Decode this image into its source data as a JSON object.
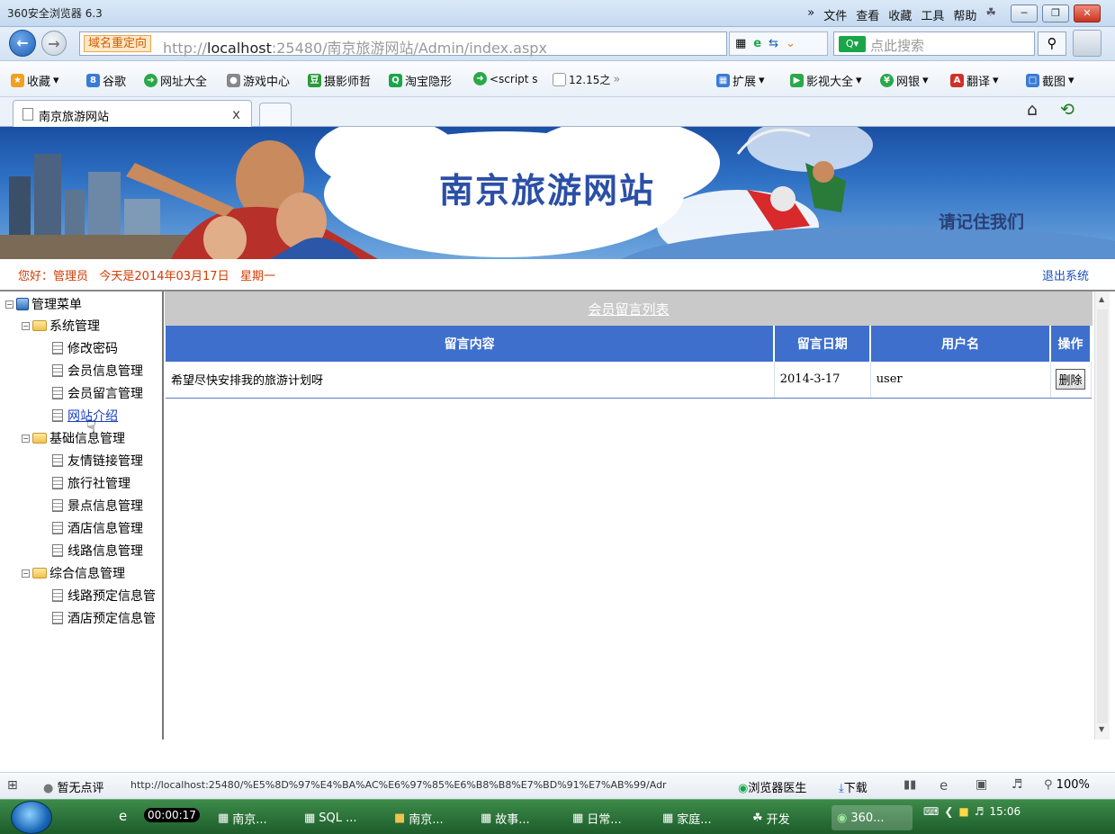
{
  "window": {
    "title": "360安全浏览器 6.3",
    "menu": [
      "文件",
      "查看",
      "收藏",
      "工具",
      "帮助"
    ],
    "menu_more": "»"
  },
  "address": {
    "redirect_label": "域名重定向",
    "url_prefix": "http://",
    "url_host": "localhost",
    "url_rest": ":25480/南京旅游网站/Admin/index.aspx",
    "search_placeholder": "点此搜索"
  },
  "favorites": [
    {
      "label": "收藏",
      "icon": "star-icon",
      "color": "#f0a020",
      "dropdown": true
    },
    {
      "label": "谷歌",
      "icon": "google-icon",
      "color": "#3a7bd5"
    },
    {
      "label": "网址大全",
      "icon": "globe-icon",
      "color": "#2aa84a"
    },
    {
      "label": "游戏中心",
      "icon": "gamepad-icon",
      "color": "#888888"
    },
    {
      "label": "摄影师哲",
      "icon": "douban-icon",
      "color": "#2a9a3a"
    },
    {
      "label": "淘宝隐形",
      "icon": "search-icon",
      "color": "#1aa54a"
    },
    {
      "label": "<script s",
      "icon": "globe-icon",
      "color": "#2aa84a"
    },
    {
      "label": "12.15之",
      "icon": "page-icon",
      "color": "#999999"
    }
  ],
  "favorites_more": "»",
  "favorites_right": [
    {
      "label": "扩展",
      "icon": "grid-icon",
      "color": "#3a7bd5"
    },
    {
      "label": "影视大全",
      "icon": "play-icon",
      "color": "#2aa84a"
    },
    {
      "label": "网银",
      "icon": "coin-icon",
      "color": "#2aa84a"
    },
    {
      "label": "翻译",
      "icon": "translate-icon",
      "color": "#d0302a"
    },
    {
      "label": "截图",
      "icon": "screenshot-icon",
      "color": "#3a7bd5"
    }
  ],
  "tab": {
    "label": "南京旅游网站",
    "close": "x"
  },
  "banner": {
    "title": "南京旅游网站",
    "slogan": "请记住我们"
  },
  "greeting": "您好：管理员   今天是2014年03月17日   星期一",
  "logout": "退出系统",
  "tree": {
    "root": "管理菜单",
    "groups": [
      {
        "label": "系统管理",
        "items": [
          "修改密码",
          "会员信息管理",
          "会员留言管理",
          "网站介绍"
        ]
      },
      {
        "label": "基础信息管理",
        "items": [
          "友情链接管理",
          "旅行社管理",
          "景点信息管理",
          "酒店信息管理",
          "线路信息管理"
        ]
      },
      {
        "label": "综合信息管理",
        "items": [
          "线路预定信息管",
          "酒店预定信息管"
        ]
      }
    ]
  },
  "list": {
    "title": "会员留言列表",
    "headers": [
      "留言内容",
      "留言日期",
      "用户名",
      "操作"
    ],
    "rows": [
      {
        "content": "希望尽快安排我的旅游计划呀",
        "date": "2014-3-17",
        "user": "user",
        "action": "删除"
      }
    ]
  },
  "status": {
    "rating": "暂无点评",
    "url": "http://localhost:25480/%E5%8D%97%E4%BA%AC%E6%97%85%E6%B8%B8%E7%BD%91%E7%AB%99/Adr",
    "doctor": "浏览器医生",
    "download": "下载",
    "zoom": "100%"
  },
  "taskbar": {
    "timer": "00:00:17",
    "tasks": [
      "南京...",
      "SQL ...",
      "南京...",
      "故事...",
      "日常...",
      "家庭...",
      "开发",
      "360..."
    ],
    "clock": "15:06"
  },
  "colors": {
    "accent": "#3e6fcc",
    "greeting": "#d53b00",
    "taskbar": "#2a6f36"
  }
}
